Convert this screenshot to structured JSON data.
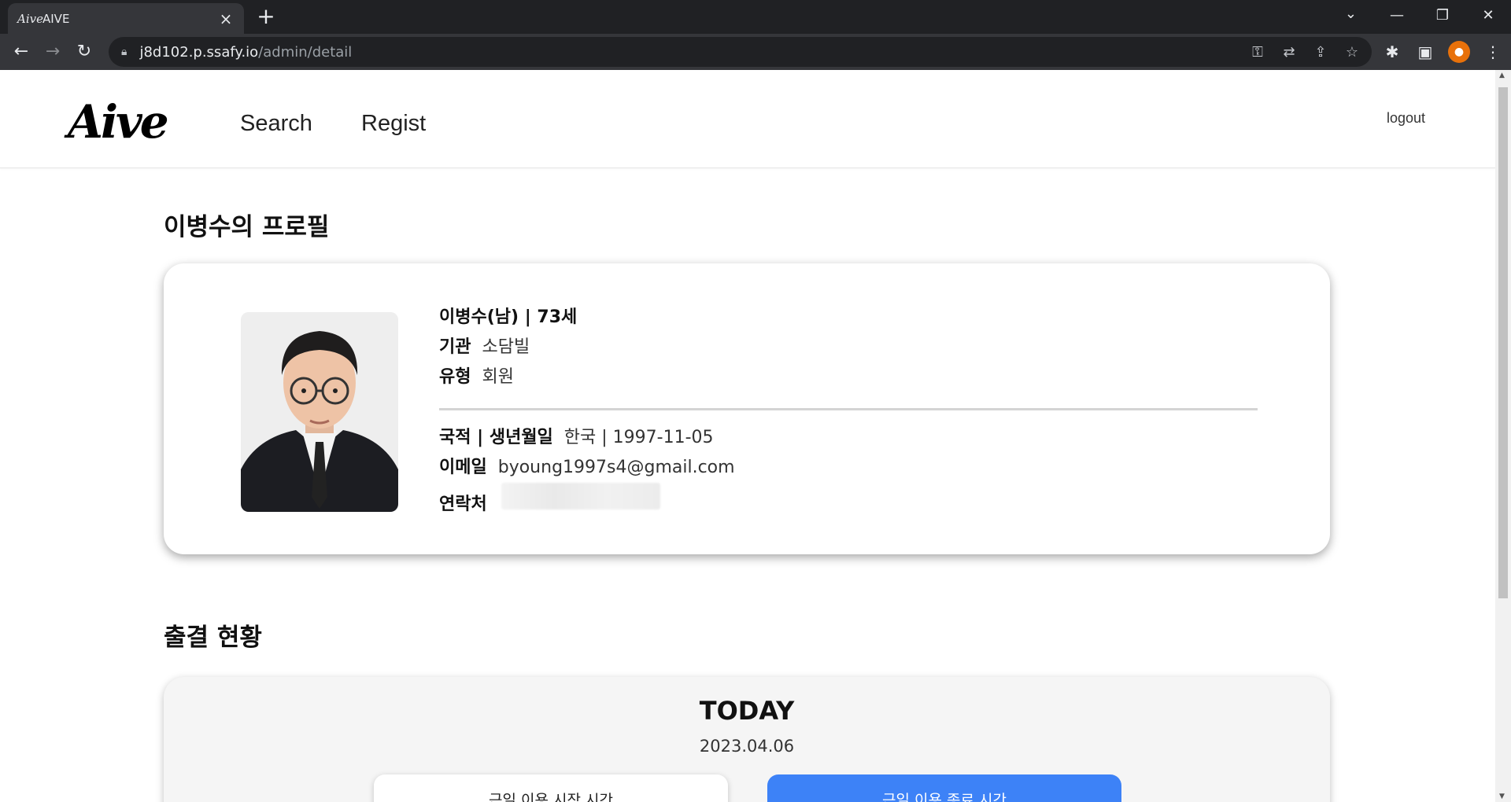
{
  "browser": {
    "tab_title": "AIVE",
    "tab_favicon_text": "Aive",
    "url_host": "j8d102.p.ssafy.io",
    "url_path": "/admin/detail"
  },
  "header": {
    "logo": "Aive",
    "nav": [
      "Search",
      "Regist"
    ],
    "logout": "logout"
  },
  "profile": {
    "section_title": "이병수의 프로필",
    "name_line": "이병수(남) | 73세",
    "org_label": "기관",
    "org_value": "소담빌",
    "type_label": "유형",
    "type_value": "회원",
    "nation_label": "국적 | 생년월일",
    "nation_value": "한국 | 1997-11-05",
    "email_label": "이메일",
    "email_value": "byoung1997s4@gmail.com",
    "phone_label": "연락처"
  },
  "attendance": {
    "section_title": "출결 현황",
    "heading": "TODAY",
    "date": "2023.04.06",
    "start_button": "근일 이용 시작 시간",
    "end_button": "근일 이용 종료 시간"
  }
}
